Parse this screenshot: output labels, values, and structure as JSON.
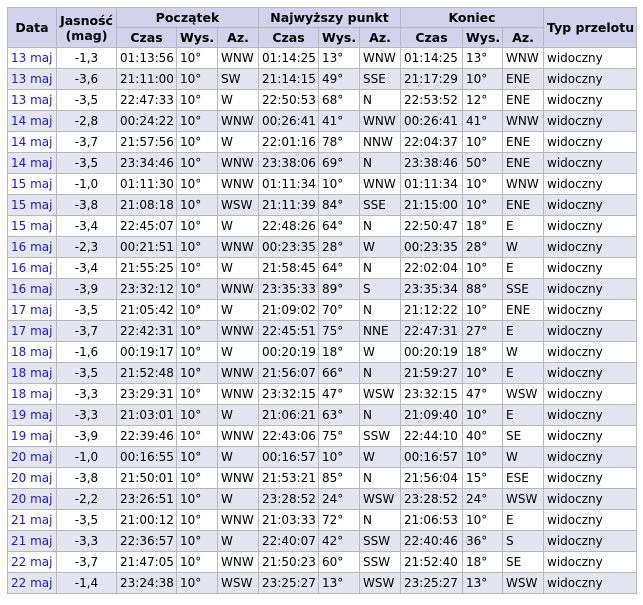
{
  "headers": {
    "date": "Data",
    "mag_top": "Jasność",
    "mag_bottom": "(mag)",
    "start": "Początek",
    "peak": "Najwyższy punkt",
    "end": "Koniec",
    "type": "Typ przelotu",
    "time": "Czas",
    "alt": "Wys.",
    "az": "Az."
  },
  "rows": [
    {
      "date": "13 maj",
      "mag": "-1,3",
      "s_time": "01:13:56",
      "s_alt": "10°",
      "s_az": "WNW",
      "p_time": "01:14:25",
      "p_alt": "13°",
      "p_az": "WNW",
      "e_time": "01:14:25",
      "e_alt": "13°",
      "e_az": "WNW",
      "type": "widoczny"
    },
    {
      "date": "13 maj",
      "mag": "-3,6",
      "s_time": "21:11:00",
      "s_alt": "10°",
      "s_az": "SW",
      "p_time": "21:14:15",
      "p_alt": "49°",
      "p_az": "SSE",
      "e_time": "21:17:29",
      "e_alt": "10°",
      "e_az": "ENE",
      "type": "widoczny"
    },
    {
      "date": "13 maj",
      "mag": "-3,5",
      "s_time": "22:47:33",
      "s_alt": "10°",
      "s_az": "W",
      "p_time": "22:50:53",
      "p_alt": "68°",
      "p_az": "N",
      "e_time": "22:53:52",
      "e_alt": "12°",
      "e_az": "ENE",
      "type": "widoczny"
    },
    {
      "date": "14 maj",
      "mag": "-2,8",
      "s_time": "00:24:22",
      "s_alt": "10°",
      "s_az": "WNW",
      "p_time": "00:26:41",
      "p_alt": "41°",
      "p_az": "WNW",
      "e_time": "00:26:41",
      "e_alt": "41°",
      "e_az": "WNW",
      "type": "widoczny"
    },
    {
      "date": "14 maj",
      "mag": "-3,7",
      "s_time": "21:57:56",
      "s_alt": "10°",
      "s_az": "W",
      "p_time": "22:01:16",
      "p_alt": "78°",
      "p_az": "NNW",
      "e_time": "22:04:37",
      "e_alt": "10°",
      "e_az": "ENE",
      "type": "widoczny"
    },
    {
      "date": "14 maj",
      "mag": "-3,5",
      "s_time": "23:34:46",
      "s_alt": "10°",
      "s_az": "WNW",
      "p_time": "23:38:06",
      "p_alt": "69°",
      "p_az": "N",
      "e_time": "23:38:46",
      "e_alt": "50°",
      "e_az": "ENE",
      "type": "widoczny"
    },
    {
      "date": "15 maj",
      "mag": "-1,0",
      "s_time": "01:11:30",
      "s_alt": "10°",
      "s_az": "WNW",
      "p_time": "01:11:34",
      "p_alt": "10°",
      "p_az": "WNW",
      "e_time": "01:11:34",
      "e_alt": "10°",
      "e_az": "WNW",
      "type": "widoczny"
    },
    {
      "date": "15 maj",
      "mag": "-3,8",
      "s_time": "21:08:18",
      "s_alt": "10°",
      "s_az": "WSW",
      "p_time": "21:11:39",
      "p_alt": "84°",
      "p_az": "SSE",
      "e_time": "21:15:00",
      "e_alt": "10°",
      "e_az": "ENE",
      "type": "widoczny"
    },
    {
      "date": "15 maj",
      "mag": "-3,4",
      "s_time": "22:45:07",
      "s_alt": "10°",
      "s_az": "W",
      "p_time": "22:48:26",
      "p_alt": "64°",
      "p_az": "N",
      "e_time": "22:50:47",
      "e_alt": "18°",
      "e_az": "E",
      "type": "widoczny"
    },
    {
      "date": "16 maj",
      "mag": "-2,3",
      "s_time": "00:21:51",
      "s_alt": "10°",
      "s_az": "WNW",
      "p_time": "00:23:35",
      "p_alt": "28°",
      "p_az": "W",
      "e_time": "00:23:35",
      "e_alt": "28°",
      "e_az": "W",
      "type": "widoczny"
    },
    {
      "date": "16 maj",
      "mag": "-3,4",
      "s_time": "21:55:25",
      "s_alt": "10°",
      "s_az": "W",
      "p_time": "21:58:45",
      "p_alt": "64°",
      "p_az": "N",
      "e_time": "22:02:04",
      "e_alt": "10°",
      "e_az": "E",
      "type": "widoczny"
    },
    {
      "date": "16 maj",
      "mag": "-3,9",
      "s_time": "23:32:12",
      "s_alt": "10°",
      "s_az": "WNW",
      "p_time": "23:35:33",
      "p_alt": "89°",
      "p_az": "S",
      "e_time": "23:35:34",
      "e_alt": "88°",
      "e_az": "SSE",
      "type": "widoczny"
    },
    {
      "date": "17 maj",
      "mag": "-3,5",
      "s_time": "21:05:42",
      "s_alt": "10°",
      "s_az": "W",
      "p_time": "21:09:02",
      "p_alt": "70°",
      "p_az": "N",
      "e_time": "21:12:22",
      "e_alt": "10°",
      "e_az": "ENE",
      "type": "widoczny"
    },
    {
      "date": "17 maj",
      "mag": "-3,7",
      "s_time": "22:42:31",
      "s_alt": "10°",
      "s_az": "WNW",
      "p_time": "22:45:51",
      "p_alt": "75°",
      "p_az": "NNE",
      "e_time": "22:47:31",
      "e_alt": "27°",
      "e_az": "E",
      "type": "widoczny"
    },
    {
      "date": "18 maj",
      "mag": "-1,6",
      "s_time": "00:19:17",
      "s_alt": "10°",
      "s_az": "W",
      "p_time": "00:20:19",
      "p_alt": "18°",
      "p_az": "W",
      "e_time": "00:20:19",
      "e_alt": "18°",
      "e_az": "W",
      "type": "widoczny"
    },
    {
      "date": "18 maj",
      "mag": "-3,5",
      "s_time": "21:52:48",
      "s_alt": "10°",
      "s_az": "WNW",
      "p_time": "21:56:07",
      "p_alt": "66°",
      "p_az": "N",
      "e_time": "21:59:27",
      "e_alt": "10°",
      "e_az": "E",
      "type": "widoczny"
    },
    {
      "date": "18 maj",
      "mag": "-3,3",
      "s_time": "23:29:31",
      "s_alt": "10°",
      "s_az": "WNW",
      "p_time": "23:32:15",
      "p_alt": "47°",
      "p_az": "WSW",
      "e_time": "23:32:15",
      "e_alt": "47°",
      "e_az": "WSW",
      "type": "widoczny"
    },
    {
      "date": "19 maj",
      "mag": "-3,3",
      "s_time": "21:03:01",
      "s_alt": "10°",
      "s_az": "W",
      "p_time": "21:06:21",
      "p_alt": "63°",
      "p_az": "N",
      "e_time": "21:09:40",
      "e_alt": "10°",
      "e_az": "E",
      "type": "widoczny"
    },
    {
      "date": "19 maj",
      "mag": "-3,9",
      "s_time": "22:39:46",
      "s_alt": "10°",
      "s_az": "WNW",
      "p_time": "22:43:06",
      "p_alt": "75°",
      "p_az": "SSW",
      "e_time": "22:44:10",
      "e_alt": "40°",
      "e_az": "SE",
      "type": "widoczny"
    },
    {
      "date": "20 maj",
      "mag": "-1,0",
      "s_time": "00:16:55",
      "s_alt": "10°",
      "s_az": "W",
      "p_time": "00:16:57",
      "p_alt": "10°",
      "p_az": "W",
      "e_time": "00:16:57",
      "e_alt": "10°",
      "e_az": "W",
      "type": "widoczny"
    },
    {
      "date": "20 maj",
      "mag": "-3,8",
      "s_time": "21:50:01",
      "s_alt": "10°",
      "s_az": "WNW",
      "p_time": "21:53:21",
      "p_alt": "85°",
      "p_az": "N",
      "e_time": "21:56:04",
      "e_alt": "15°",
      "e_az": "ESE",
      "type": "widoczny"
    },
    {
      "date": "20 maj",
      "mag": "-2,2",
      "s_time": "23:26:51",
      "s_alt": "10°",
      "s_az": "W",
      "p_time": "23:28:52",
      "p_alt": "24°",
      "p_az": "WSW",
      "e_time": "23:28:52",
      "e_alt": "24°",
      "e_az": "WSW",
      "type": "widoczny"
    },
    {
      "date": "21 maj",
      "mag": "-3,5",
      "s_time": "21:00:12",
      "s_alt": "10°",
      "s_az": "WNW",
      "p_time": "21:03:33",
      "p_alt": "72°",
      "p_az": "N",
      "e_time": "21:06:53",
      "e_alt": "10°",
      "e_az": "E",
      "type": "widoczny"
    },
    {
      "date": "21 maj",
      "mag": "-3,3",
      "s_time": "22:36:57",
      "s_alt": "10°",
      "s_az": "W",
      "p_time": "22:40:07",
      "p_alt": "42°",
      "p_az": "SSW",
      "e_time": "22:40:46",
      "e_alt": "36°",
      "e_az": "S",
      "type": "widoczny"
    },
    {
      "date": "22 maj",
      "mag": "-3,7",
      "s_time": "21:47:05",
      "s_alt": "10°",
      "s_az": "WNW",
      "p_time": "21:50:23",
      "p_alt": "60°",
      "p_az": "SSW",
      "e_time": "21:52:40",
      "e_alt": "18°",
      "e_az": "SE",
      "type": "widoczny"
    },
    {
      "date": "22 maj",
      "mag": "-1,4",
      "s_time": "23:24:38",
      "s_alt": "10°",
      "s_az": "WSW",
      "p_time": "23:25:27",
      "p_alt": "13°",
      "p_az": "WSW",
      "e_time": "23:25:27",
      "e_alt": "13°",
      "e_az": "WSW",
      "type": "widoczny"
    }
  ]
}
